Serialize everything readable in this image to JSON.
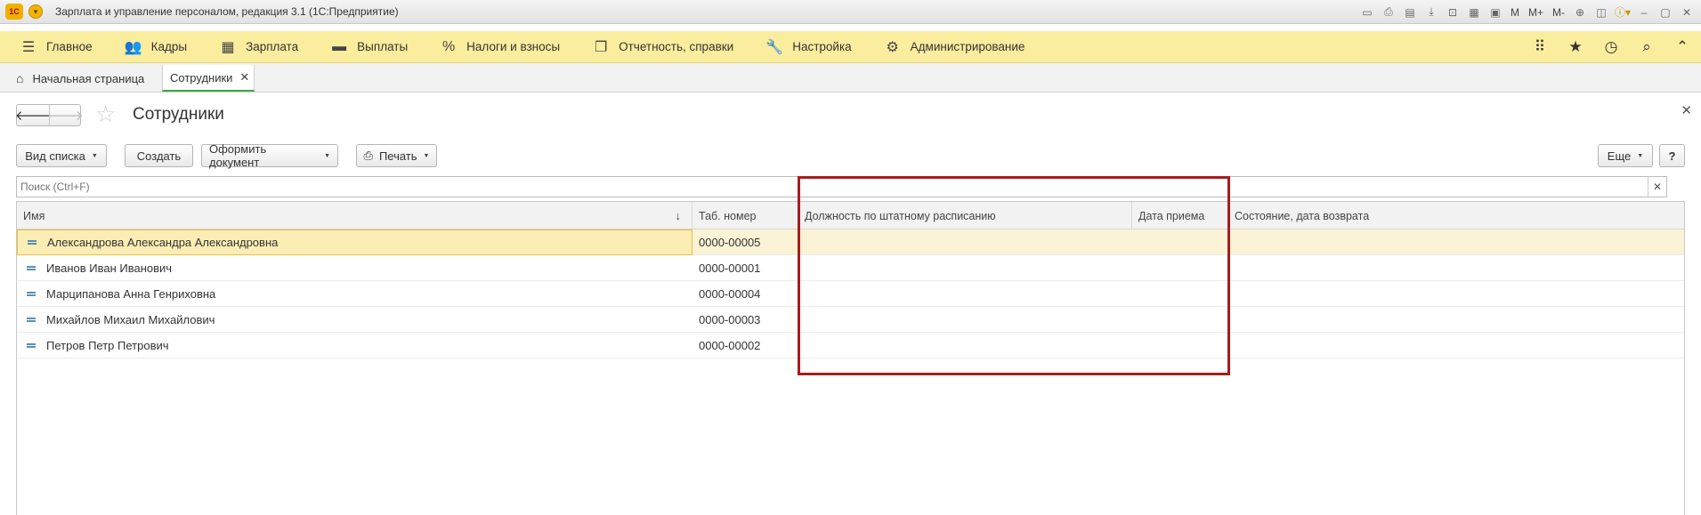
{
  "window": {
    "title": "Зарплата и управление персоналом, редакция 3.1  (1С:Предприятие)",
    "logo_text": "1С",
    "tools": [
      "M",
      "M+",
      "M-"
    ]
  },
  "main_menu": [
    {
      "label": "Главное",
      "icon": "hamburger-icon"
    },
    {
      "label": "Кадры",
      "icon": "people-icon"
    },
    {
      "label": "Зарплата",
      "icon": "calculator-icon"
    },
    {
      "label": "Выплаты",
      "icon": "wallet-icon"
    },
    {
      "label": "Налоги и взносы",
      "icon": "percent-icon"
    },
    {
      "label": "Отчетность, справки",
      "icon": "reports-icon"
    },
    {
      "label": "Настройка",
      "icon": "wrench-icon"
    },
    {
      "label": "Администрирование",
      "icon": "gear-icon"
    }
  ],
  "tabs": {
    "home": "Начальная страница",
    "employees": "Сотрудники"
  },
  "form": {
    "title": "Сотрудники"
  },
  "toolbar": {
    "view_list": "Вид списка",
    "create": "Создать",
    "make_document": "Оформить документ",
    "print": "Печать",
    "more": "Еще",
    "help": "?"
  },
  "search": {
    "placeholder": "Поиск (Ctrl+F)"
  },
  "table": {
    "columns": {
      "name": "Имя",
      "tab_number": "Таб. номер",
      "position": "Должность по штатному расписанию",
      "hire_date": "Дата приема",
      "status": "Состояние, дата возврата"
    },
    "rows": [
      {
        "name": "Александрова Александра Александровна",
        "tab_number": "0000-00005",
        "selected": true
      },
      {
        "name": "Иванов Иван Иванович",
        "tab_number": "0000-00001"
      },
      {
        "name": "Марципанова Анна Генриховна",
        "tab_number": "0000-00004"
      },
      {
        "name": "Михайлов Михаил Михайлович",
        "tab_number": "0000-00003"
      },
      {
        "name": "Петров Петр Петрович",
        "tab_number": "0000-00002"
      }
    ]
  },
  "annotation_color": "#a81c1c",
  "accent_color": "#fbed9e"
}
